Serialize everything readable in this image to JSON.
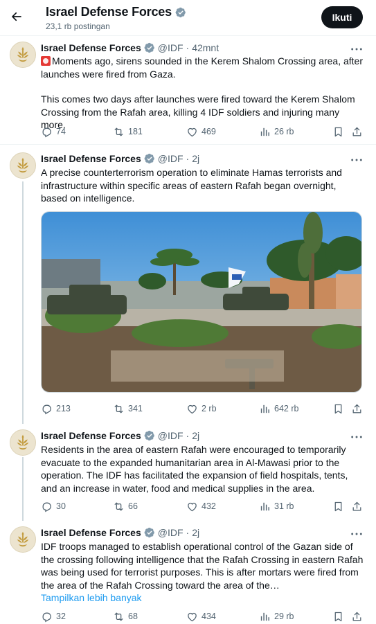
{
  "header": {
    "title": "Israel Defense Forces",
    "post_count": "23,1 rb postingan",
    "follow_label": "Ikuti"
  },
  "posts": [
    {
      "name": "Israel Defense Forces",
      "handle": "@IDF",
      "time": "42mnt",
      "text_p1": "Moments ago, sirens sounded in the Kerem Shalom Crossing area, after launches were fired from Gaza.",
      "text_p2": "This comes two days after launches were fired toward the Kerem Shalom Crossing from the Rafah area, killing 4 IDF soldiers and injuring many more.",
      "replies": "74",
      "reposts": "181",
      "likes": "469",
      "views": "26 rb"
    },
    {
      "name": "Israel Defense Forces",
      "handle": "@IDF",
      "time": "2j",
      "text": "A precise counterterrorism operation to eliminate Hamas terrorists and infrastructure within specific areas of eastern Rafah began overnight, based on intelligence.",
      "replies": "213",
      "reposts": "341",
      "likes": "2 rb",
      "views": "642 rb"
    },
    {
      "name": "Israel Defense Forces",
      "handle": "@IDF",
      "time": "2j",
      "text": "Residents in the area of eastern Rafah were encouraged to temporarily evacuate to the expanded humanitarian area in Al-Mawasi prior to the operation. The IDF has facilitated the expansion of field hospitals, tents, and an increase in water, food and medical supplies in the area.",
      "replies": "30",
      "reposts": "66",
      "likes": "432",
      "views": "31 rb"
    },
    {
      "name": "Israel Defense Forces",
      "handle": "@IDF",
      "time": "2j",
      "text": "IDF troops managed to establish operational control of the Gazan side of the crossing following intelligence that the Rafah Crossing in eastern Rafah was being used for terrorist purposes. This is after mortars were fired from the area of the Rafah Crossing toward the area of the…",
      "show_more": "Tampilkan lebih banyak",
      "replies": "32",
      "reposts": "68",
      "likes": "434",
      "views": "29 rb"
    }
  ],
  "colors": {
    "accent": "#1d9bf0",
    "verified": "#829aab",
    "text_primary": "#0f1419",
    "text_secondary": "#536471"
  },
  "icons": [
    "back-arrow-icon",
    "verified-badge-icon",
    "more-icon",
    "reply-icon",
    "repost-icon",
    "like-icon",
    "views-icon",
    "bookmark-icon",
    "share-icon",
    "siren-emoji-icon"
  ]
}
